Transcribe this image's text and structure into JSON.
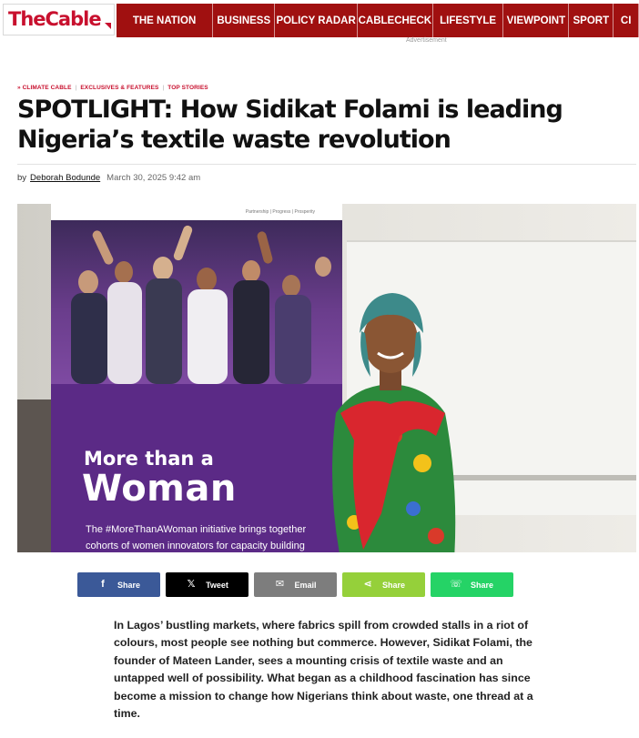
{
  "brand": {
    "logo_text": "TheCable",
    "accent_color": "#c8102e",
    "nav_color": "#a01010"
  },
  "nav": {
    "items": [
      "THE NATION",
      "BUSINESS",
      "POLICY RADAR",
      "CABLECHECK",
      "LIFESTYLE",
      "VIEWPOINT",
      "SPORT",
      "CI"
    ]
  },
  "ad_label": "Advertisement",
  "article": {
    "categories": [
      {
        "label": "» CLIMATE CABLE"
      },
      {
        "label": "EXCLUSIVES & FEATURES"
      },
      {
        "label": "TOP STORIES"
      }
    ],
    "headline": "SPOTLIGHT: How Sidikat Folami is leading Nigeria’s textile waste revolution",
    "byline_prefix": "by",
    "author": "Deborah Bodunde",
    "date": "March 30, 2025 9:42 am",
    "hero_image": {
      "banner_text_1": "More than a",
      "banner_text_2": "Woman",
      "banner_small_1": "The #MoreThanAWoman initiative brings together",
      "banner_small_2": "cohorts of women innovators for capacity building",
      "banner_top_text": "Partnership | Progress | Prosperity"
    },
    "body_paragraph": "In Lagos’ bustling markets, where fabrics spill from crowded stalls in a riot of colours, most people see nothing but commerce. However, Sidikat Folami, the founder of Mateen Lander, sees a mounting crisis of textile waste and an untapped well of possibility. What began as a childhood fascination has since become a mission to change how Nigerians think about waste, one thread at a time."
  },
  "share": {
    "buttons": [
      {
        "label": "Share",
        "icon": "facebook-icon",
        "glyph": "f",
        "color": "#3b5998"
      },
      {
        "label": "Tweet",
        "icon": "x-icon",
        "glyph": "𝕏",
        "color": "#000000"
      },
      {
        "label": "Email",
        "icon": "email-icon",
        "glyph": "✉",
        "color": "#7d7d7d"
      },
      {
        "label": "Share",
        "icon": "share-icon",
        "glyph": "⋖",
        "color": "#95d03a"
      },
      {
        "label": "Share",
        "icon": "whatsapp-icon",
        "glyph": "☏",
        "color": "#25d366"
      }
    ]
  }
}
